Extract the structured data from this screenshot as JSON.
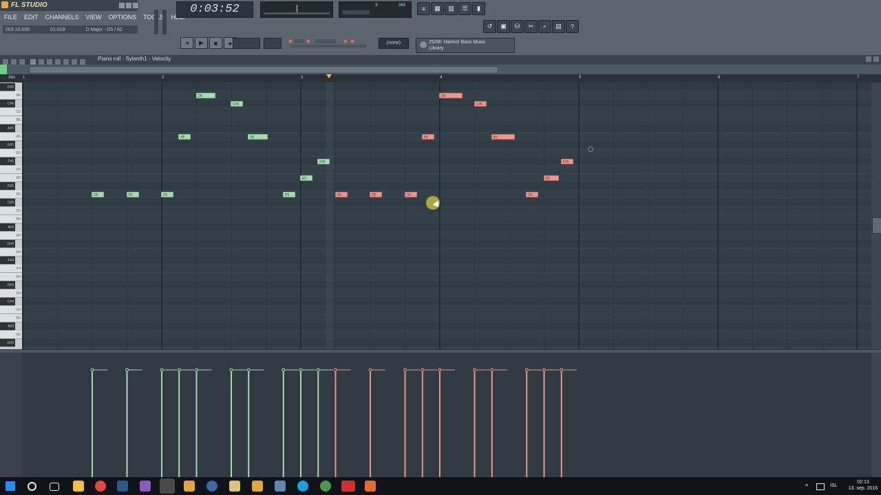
{
  "app": {
    "title": "FL STUDIO",
    "menu": [
      "FILE",
      "EDIT",
      "CHANNELS",
      "VIEW",
      "OPTIONS",
      "TOOLS",
      "HELP"
    ],
    "hint_left": "003:16:005",
    "hint_mid": "01:018",
    "hint_right": "D Major - D5 / 62"
  },
  "toolbar": {
    "time": "0:03:52",
    "cpu_value": "3",
    "mem_value": "363",
    "pattern_selector": "(none)",
    "browser_line1": "25/08: Harmor Bass Music",
    "browser_line2": "Library"
  },
  "piano_roll": {
    "title": "Piano roll - Sylenth1 - Velocity",
    "bars": [
      "1",
      "2",
      "3",
      "4",
      "5",
      "6",
      "7"
    ],
    "keys": [
      {
        "label": "D#6",
        "black": true
      },
      {
        "label": "D6",
        "black": false
      },
      {
        "label": "C#6",
        "black": true
      },
      {
        "label": "C6",
        "black": false
      },
      {
        "label": "B5",
        "black": false
      },
      {
        "label": "A#5",
        "black": true
      },
      {
        "label": "A5",
        "black": false
      },
      {
        "label": "G#5",
        "black": true
      },
      {
        "label": "G5",
        "black": false
      },
      {
        "label": "F#5",
        "black": true
      },
      {
        "label": "F5",
        "black": false
      },
      {
        "label": "E5",
        "black": false
      },
      {
        "label": "D#5",
        "black": true
      },
      {
        "label": "D5",
        "black": false
      },
      {
        "label": "C#5",
        "black": true
      },
      {
        "label": "C5",
        "black": false
      },
      {
        "label": "B4",
        "black": false
      },
      {
        "label": "A#4",
        "black": true
      },
      {
        "label": "A4",
        "black": false
      },
      {
        "label": "G#4",
        "black": true
      },
      {
        "label": "G4",
        "black": false
      },
      {
        "label": "F#4",
        "black": true
      },
      {
        "label": "F4",
        "black": false
      },
      {
        "label": "E4",
        "black": false
      },
      {
        "label": "D#4",
        "black": true
      },
      {
        "label": "D4",
        "black": false
      },
      {
        "label": "C#4",
        "black": true
      },
      {
        "label": "C4",
        "black": false
      },
      {
        "label": "B3",
        "black": false
      },
      {
        "label": "A#3",
        "black": true
      },
      {
        "label": "A3",
        "black": false
      },
      {
        "label": "G#3",
        "black": true
      }
    ],
    "notes": [
      {
        "pitch": "D5",
        "start": 1.5,
        "length": 0.375,
        "color": "green"
      },
      {
        "pitch": "D5",
        "start": 1.75,
        "length": 0.375,
        "color": "green"
      },
      {
        "pitch": "D5",
        "start": 2.0,
        "length": 0.375,
        "color": "green"
      },
      {
        "pitch": "A5",
        "start": 2.125,
        "length": 0.375,
        "color": "green"
      },
      {
        "pitch": "D6",
        "start": 2.25,
        "length": 0.625,
        "color": "green"
      },
      {
        "pitch": "C#6",
        "start": 2.5,
        "length": 0.375,
        "color": "green"
      },
      {
        "pitch": "A5",
        "start": 2.625,
        "length": 0.625,
        "color": "green"
      },
      {
        "pitch": "D5",
        "start": 2.875,
        "length": 0.375,
        "color": "green"
      },
      {
        "pitch": "E5",
        "start": 3.0,
        "length": 0.375,
        "color": "green"
      },
      {
        "pitch": "F#5",
        "start": 3.125,
        "length": 0.375,
        "color": "green"
      },
      {
        "pitch": "D5",
        "start": 3.25,
        "length": 0.375,
        "color": "red"
      },
      {
        "pitch": "D5",
        "start": 3.5,
        "length": 0.375,
        "color": "red"
      },
      {
        "pitch": "D5",
        "start": 3.75,
        "length": 0.375,
        "color": "red"
      },
      {
        "pitch": "A5",
        "start": 3.875,
        "length": 0.375,
        "color": "red"
      },
      {
        "pitch": "D6",
        "start": 4.0,
        "length": 0.75,
        "color": "red"
      },
      {
        "pitch": "C#6",
        "start": 4.25,
        "length": 0.375,
        "color": "red"
      },
      {
        "pitch": "A5",
        "start": 4.375,
        "length": 0.75,
        "color": "red"
      },
      {
        "pitch": "D5",
        "start": 4.625,
        "length": 0.375,
        "color": "red"
      },
      {
        "pitch": "E5",
        "start": 4.75,
        "length": 0.5,
        "color": "red"
      },
      {
        "pitch": "F#5",
        "start": 4.875,
        "length": 0.375,
        "color": "red"
      }
    ]
  },
  "colors": {
    "green_note": "#a4dcb0",
    "red_note": "#f2948e"
  },
  "taskbar": {
    "language": "ISL",
    "time": "02:13",
    "date": "13. sep. 2016"
  }
}
